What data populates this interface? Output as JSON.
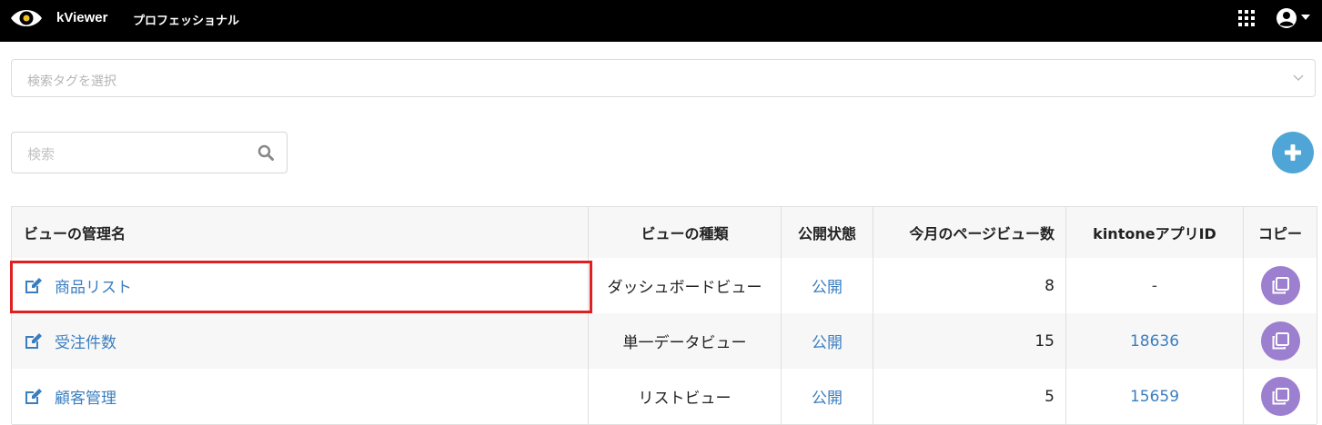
{
  "header": {
    "brand": "kViewer",
    "plan": "プロフェッショナル",
    "icons": [
      "eye-logo-icon",
      "apps-grid-icon",
      "user-account-icon",
      "caret-down-icon"
    ]
  },
  "tag_select": {
    "placeholder": "検索タグを選択"
  },
  "search": {
    "placeholder": "検索"
  },
  "colors": {
    "accent_add": "#4fa6d6",
    "copy_button": "#9c7fcf",
    "link": "#3a7ec0",
    "highlight": "#e02020"
  },
  "table": {
    "columns": [
      "ビューの管理名",
      "ビューの種類",
      "公開状態",
      "今月のページビュー数",
      "kintoneアプリID",
      "コピー"
    ],
    "rows": [
      {
        "name": "商品リスト",
        "type": "ダッシュボードビュー",
        "status": "公開",
        "page_views": "8",
        "app_id": "-"
      },
      {
        "name": "受注件数",
        "type": "単一データビュー",
        "status": "公開",
        "page_views": "15",
        "app_id": "18636"
      },
      {
        "name": "顧客管理",
        "type": "リストビュー",
        "status": "公開",
        "page_views": "5",
        "app_id": "15659"
      }
    ]
  }
}
